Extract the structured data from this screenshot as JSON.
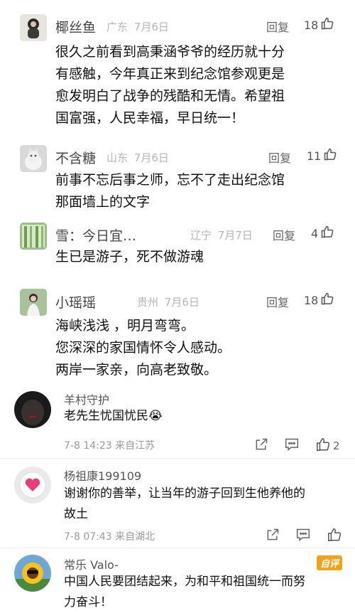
{
  "comments_a": [
    {
      "name": "椰丝鱼",
      "region": "广东",
      "date": "7月6日",
      "reply": "回复",
      "likes": "18",
      "lines": [
        "很久之前看到高秉涵爷爷的经历就十分",
        "有感触，今年真正来到纪念馆参观更是",
        "愈发明白了战争的残酷和无情。希望祖",
        "国富强，人民幸福，早日统一！"
      ]
    },
    {
      "name": "不含糖",
      "region": "山东",
      "date": "7月6日",
      "reply": "回复",
      "likes": "11",
      "lines": [
        "前事不忘后事之师，忘不了走出纪念馆",
        "那面墙上的文字"
      ]
    },
    {
      "name": "雪：今日宜…",
      "region": "辽宁",
      "date": "7月7日",
      "reply": "回复",
      "likes": "4",
      "lines": [
        "生已是游子，死不做游魂"
      ]
    },
    {
      "name": "小瑶瑶",
      "region": "贵州",
      "date": "7月6日",
      "reply": "回复",
      "likes": "18",
      "lines": [
        "海峡浅浅 ，明月弯弯。",
        "您深深的家国情怀令人感动。",
        "两岸一家亲，向高老致敬。"
      ]
    }
  ],
  "comments_b": [
    {
      "name": "羊村守护",
      "lines": [
        "老先生忧国忧民😭"
      ],
      "time": "7-8 14:23 来自江苏",
      "likes": "2"
    },
    {
      "name": "杨祖康199109",
      "lines": [
        "谢谢你的善举，让当年的游子回到生他养他的",
        "故土"
      ],
      "time": "7-8 07:43 来自湖北",
      "likes": ""
    },
    {
      "name": "常乐 Valo-",
      "badge": "自评",
      "lines": [
        "中国人民要团结起来，为和平和祖国统一而努",
        "力奋斗！"
      ]
    }
  ],
  "icons": {
    "like": "thumb-up-icon",
    "share": "share-icon",
    "comment": "comment-icon"
  },
  "colors": {
    "badge": "#f3a31a",
    "meta": "#b5b5b5"
  }
}
